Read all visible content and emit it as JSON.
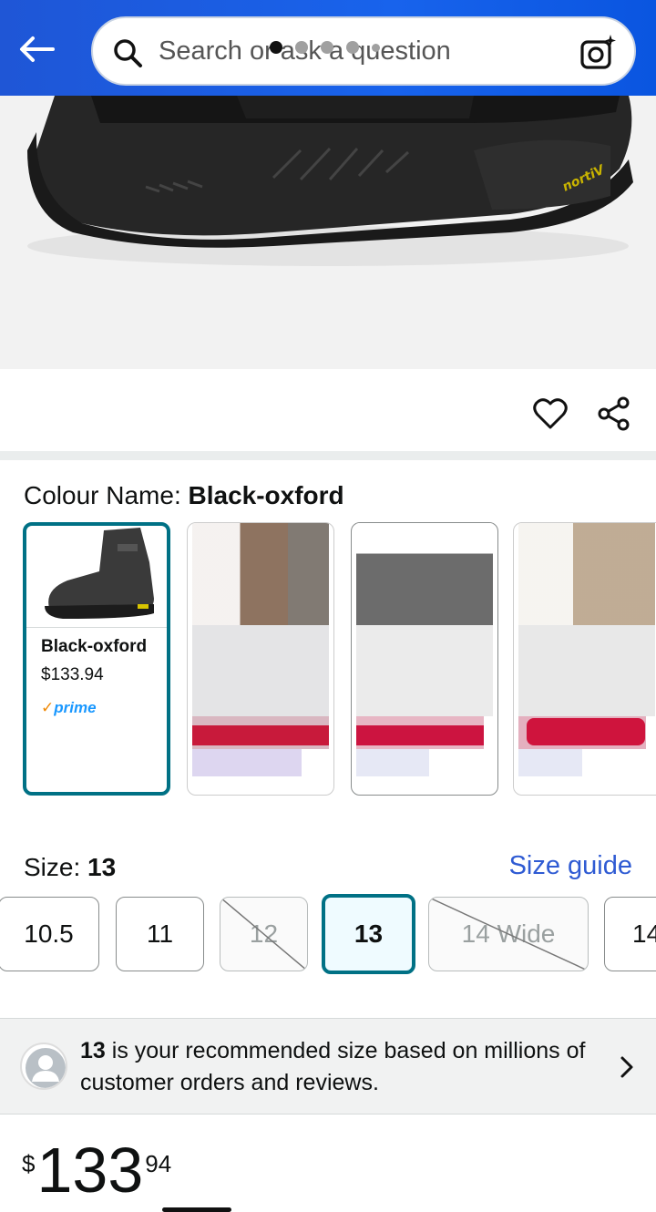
{
  "search": {
    "placeholder": "Search or ask a question"
  },
  "carousel": {
    "dot_count": 5,
    "active_index": 0
  },
  "colour": {
    "label": "Colour Name:",
    "selected": "Black-oxford",
    "swatches": [
      {
        "name": "Black-oxford",
        "price": "$133.94",
        "prime": "prime"
      }
    ]
  },
  "size": {
    "label": "Size:",
    "selected": "13",
    "guide_label": "Size guide",
    "options": [
      "10.5",
      "11",
      "12",
      "13",
      "14 Wide",
      "14"
    ]
  },
  "recommendation": {
    "size": "13",
    "text": " is your recommended size based on millions of customer orders and reviews."
  },
  "price": {
    "symbol": "$",
    "whole": "133",
    "fraction": "94"
  },
  "colors": {
    "accent": "#007185",
    "topbar": "#1863ec",
    "link": "#2f5bd3",
    "prime": "#1a98ff"
  }
}
